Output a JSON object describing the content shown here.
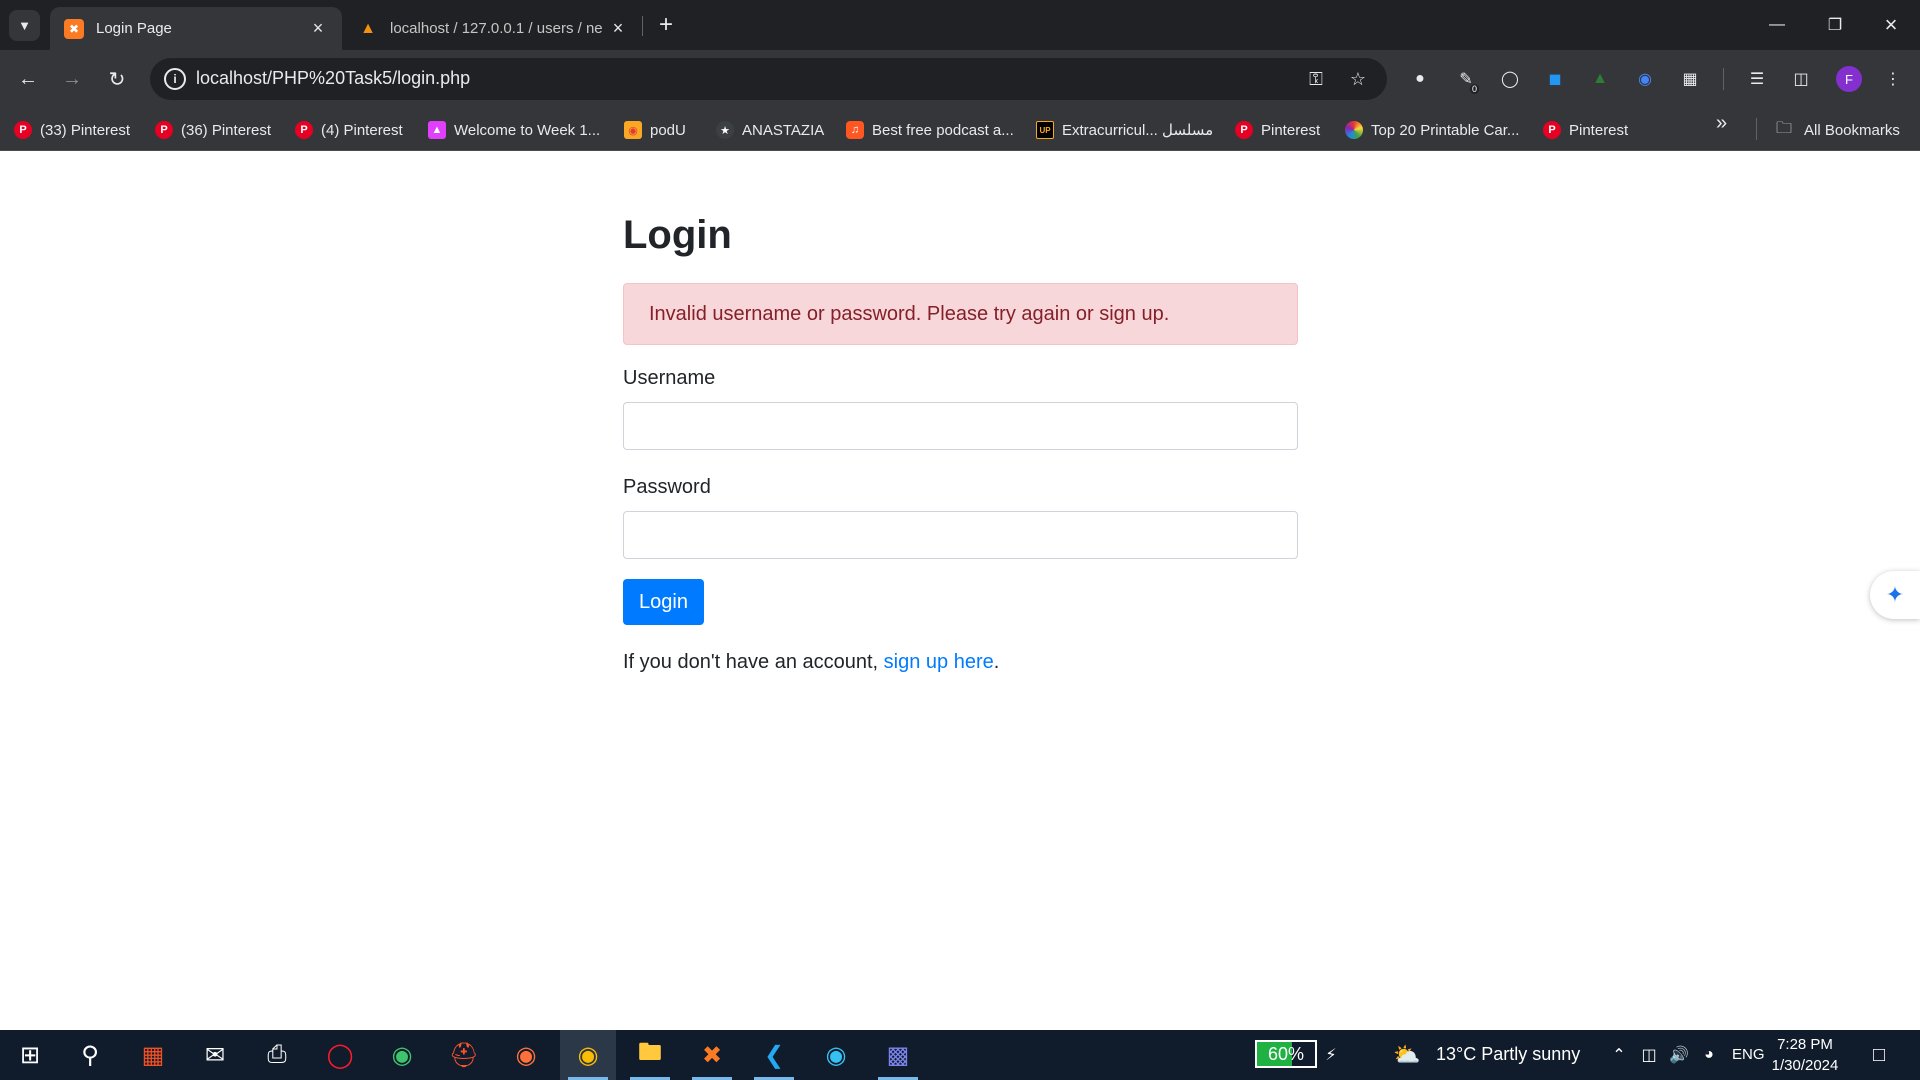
{
  "browser": {
    "tabs": [
      {
        "title": "Login Page",
        "active": true
      },
      {
        "title": "localhost / 127.0.0.1 / users / ne",
        "active": false
      }
    ],
    "new_tab": "+",
    "address": "localhost/PHP%20Task5/login.php",
    "profile_initial": "F",
    "extension_badge": "0"
  },
  "bookmarks": [
    {
      "label": "(33) Pinterest",
      "icon": "pinterest-icon",
      "color": "#e60023"
    },
    {
      "label": "(36) Pinterest",
      "icon": "pinterest-icon",
      "color": "#e60023"
    },
    {
      "label": "(4) Pinterest",
      "icon": "pinterest-icon",
      "color": "#e60023"
    },
    {
      "label": "Welcome to Week 1...",
      "icon": "course-icon",
      "color": "#e040fb"
    },
    {
      "label": "podU",
      "icon": "podu-icon",
      "color": "#f9a825"
    },
    {
      "label": "ANASTAZIA",
      "icon": "star-icon",
      "color": "#3c4043"
    },
    {
      "label": "Best free podcast a...",
      "icon": "podcast-icon",
      "color": "#ff5722"
    },
    {
      "label": "Extracurricul... مسلسل",
      "icon": "up-icon",
      "color": "#000000"
    },
    {
      "label": "Pinterest",
      "icon": "pinterest-icon",
      "color": "#e60023"
    },
    {
      "label": "Top 20 Printable Car...",
      "icon": "colorful-icon",
      "color": "#7b1fa2"
    },
    {
      "label": "Pinterest",
      "icon": "pinterest-icon",
      "color": "#e60023"
    }
  ],
  "all_bookmarks": "All Bookmarks",
  "page": {
    "heading": "Login",
    "alert": "Invalid username or password. Please try again or sign up.",
    "username_label": "Username",
    "username_value": "",
    "password_label": "Password",
    "password_value": "",
    "login_button": "Login",
    "signup_prefix": "If you don't have an account, ",
    "signup_link": "sign up here",
    "signup_suffix": "."
  },
  "taskbar": {
    "battery_percent": "60%",
    "battery_level": 60,
    "weather": "13°C  Partly sunny",
    "language": "ENG",
    "time": "7:28 PM",
    "date": "1/30/2024"
  },
  "colors": {
    "primary": "#007bff",
    "alert_bg": "#f8d7da",
    "alert_text": "#842029"
  }
}
